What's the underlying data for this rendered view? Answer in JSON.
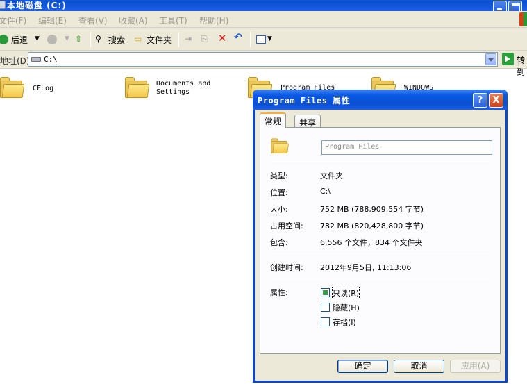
{
  "window": {
    "title": "本地磁盘 (C:)"
  },
  "menu": {
    "items": [
      "文件(F)",
      "编辑(E)",
      "查看(V)",
      "收藏(A)",
      "工具(T)",
      "帮助(H)"
    ]
  },
  "toolbar": {
    "back_label": "后退",
    "search_label": "搜索",
    "folders_label": "文件夹"
  },
  "address": {
    "label": "地址(D)",
    "value": "C:\\",
    "go_label": "转到"
  },
  "files": [
    {
      "name": "CFLog"
    },
    {
      "name": "Documents and Settings"
    },
    {
      "name": "Program Files"
    },
    {
      "name": "WINDOWS"
    }
  ],
  "dialog": {
    "title": "Program Files 属性",
    "help": "?",
    "close": "X",
    "tabs": [
      "常规",
      "共享"
    ],
    "name_value": "Program Files",
    "properties": [
      {
        "label": "类型:",
        "value": "文件夹"
      },
      {
        "label": "位置:",
        "value": "C:\\"
      },
      {
        "label": "大小:",
        "value": "752 MB (788,909,554 字节)"
      },
      {
        "label": "占用空间:",
        "value": "782 MB (820,428,800 字节)"
      },
      {
        "label": "包含:",
        "value": "6,556 个文件，834 个文件夹"
      }
    ],
    "created": {
      "label": "创建时间:",
      "value": "2012年9月5日, 11:13:06"
    },
    "attributes": {
      "label": "属性:",
      "options": [
        {
          "label": "只读(R)",
          "state": "indeterminate"
        },
        {
          "label": "隐藏(H)",
          "state": "unchecked"
        },
        {
          "label": "存档(I)",
          "state": "unchecked"
        }
      ]
    },
    "buttons": {
      "ok": "确定",
      "cancel": "取消",
      "apply": "应用(A)"
    }
  }
}
